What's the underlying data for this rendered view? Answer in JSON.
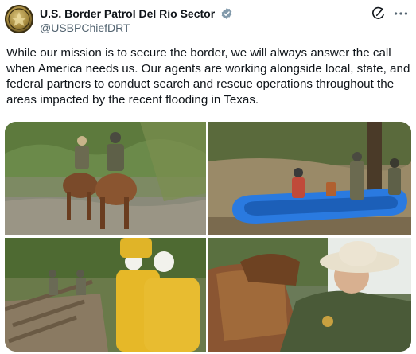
{
  "post": {
    "author": {
      "display_name": "U.S. Border Patrol Del Rio Sector",
      "handle": "@USBPChiefDRT",
      "verified_icon": "verified-badge-icon",
      "avatar_icon": "border-patrol-seal-icon"
    },
    "actions": {
      "grok_icon": "grok-icon",
      "more_icon": "more-options-icon"
    },
    "text": "While our mission is to secure the border, we will always answer the call when America needs us. Our agents are working alongside local, state, and federal partners to conduct search and rescue operations throughout the areas impacted by the recent flooding in Texas.",
    "media": [
      {
        "kind": "photo",
        "subject": "agents on horseback in flood water"
      },
      {
        "kind": "photo",
        "subject": "agents with blue raft in river"
      },
      {
        "kind": "photo",
        "subject": "responders in yellow gear at debris"
      },
      {
        "kind": "photo",
        "subject": "agent in cowboy hat saddling horse"
      }
    ]
  },
  "colors": {
    "text": "#0f1419",
    "secondary": "#536471",
    "verified": "#829aab"
  }
}
